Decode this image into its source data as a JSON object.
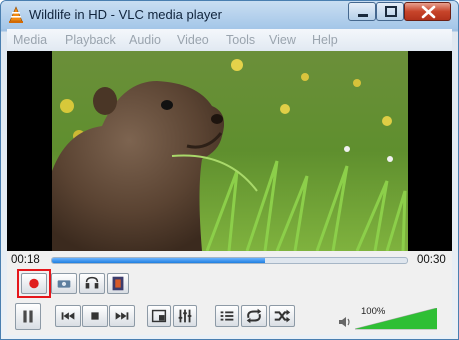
{
  "window": {
    "title": "Wildlife in HD - VLC media player"
  },
  "menu": {
    "items": [
      "Media",
      "Playback",
      "Audio",
      "Video",
      "Tools",
      "View",
      "Help"
    ]
  },
  "playback": {
    "elapsed": "00:18",
    "total": "00:30",
    "progress": 0.6
  },
  "volume": {
    "label": "100%",
    "level": 1.0
  },
  "colors": {
    "highlight": "#e5161b",
    "record": "#e01e1e",
    "seek": "#1f7fe0",
    "volume": "#2fbf35"
  },
  "icons": {
    "app": "vlc-cone-icon",
    "advanced": [
      "record-icon",
      "snapshot-icon",
      "loop-ab-icon",
      "frame-step-icon"
    ],
    "main": [
      "pause-icon",
      "previous-icon",
      "stop-icon",
      "next-icon",
      "fullscreen-icon",
      "extended-settings-icon",
      "playlist-icon",
      "loop-icon",
      "shuffle-icon",
      "speaker-icon"
    ]
  }
}
